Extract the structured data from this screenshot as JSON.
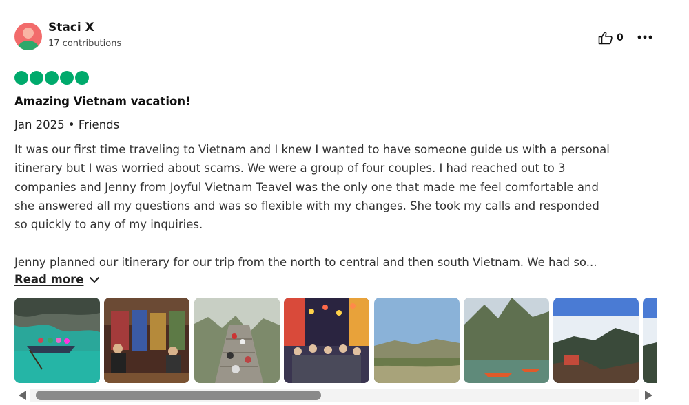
{
  "reviewer": {
    "name": "Staci X",
    "contributions": "17 contributions"
  },
  "actions": {
    "like_count": "0"
  },
  "review": {
    "rating": 5,
    "title": "Amazing Vietnam vacation!",
    "meta": "Jan 2025 • Friends",
    "lines": [
      "It was our first time traveling to Vietnam and I knew I wanted to have someone guide us with a personal",
      "itinerary but I was worried about scams. We were a group of four couples. I had reached out to 3",
      "companies and Jenny from Joyful Vietnam Teavel was the only one that made me feel comfortable and",
      "she answered all my questions and was so flexible with my changes. She took my calls and responded",
      "so quickly to any of my inquiries.",
      "Jenny planned our itinerary for our trip from the north to central and then south Vietnam. We had so..."
    ],
    "read_more_label": "Read more"
  },
  "colors": {
    "rating_bubble": "#00aa6c",
    "avatar_bg": "#f26b6b",
    "scroll_thumb": "#8a8a8a"
  },
  "photos_scroll": {
    "position_fraction": 0.0,
    "visible_fraction": 0.47
  }
}
